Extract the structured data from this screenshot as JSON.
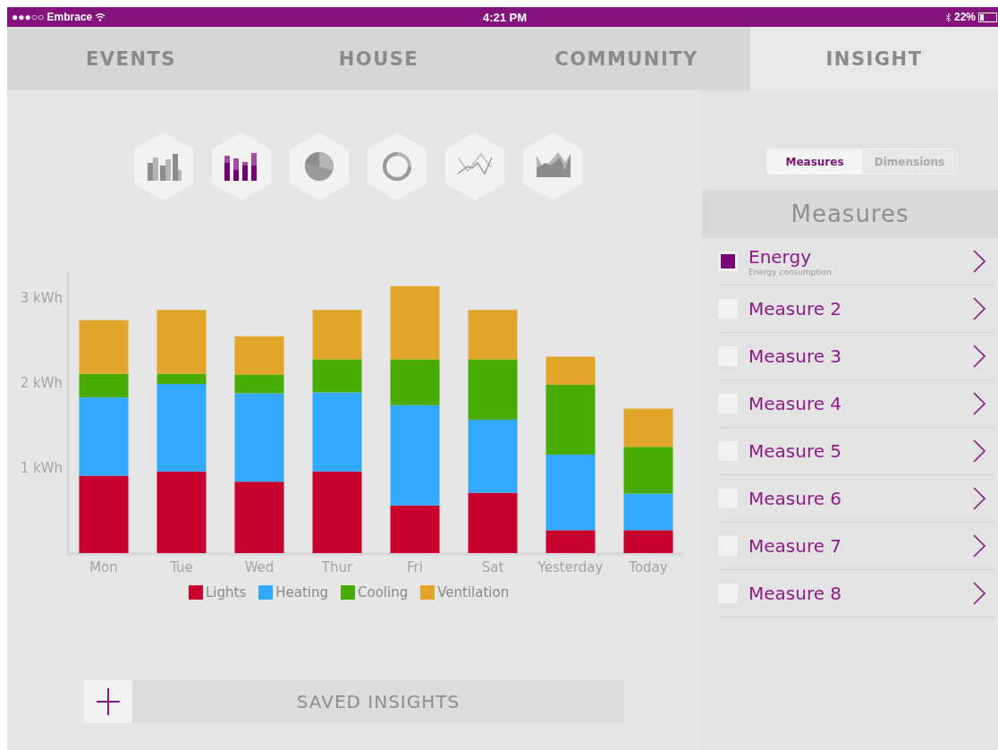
{
  "status_bar": {
    "carrier": "●●●○○ Embrace",
    "time": "4:21 PM",
    "battery": "22%"
  },
  "tabs": [
    {
      "label": "EVENTS",
      "selected": false
    },
    {
      "label": "HOUSE",
      "selected": false
    },
    {
      "label": "COMMUNITY",
      "selected": false
    },
    {
      "label": "INSIGHT",
      "selected": true
    }
  ],
  "chart_types": [
    {
      "kind": "bar",
      "selected": false
    },
    {
      "kind": "stacked",
      "selected": true
    },
    {
      "kind": "pie",
      "selected": false
    },
    {
      "kind": "donut",
      "selected": false
    },
    {
      "kind": "line",
      "selected": false
    },
    {
      "kind": "area",
      "selected": false
    }
  ],
  "chart": {
    "chart_data": {
      "type": "bar",
      "stacked": true,
      "categories": [
        "Mon",
        "Tue",
        "Wed",
        "Thur",
        "Fri",
        "Sat",
        "Yesterday",
        "Today"
      ],
      "ylim": [
        0,
        3.3
      ],
      "yticks": [
        {
          "value": 1,
          "label": "1 kWh"
        },
        {
          "value": 2,
          "label": "2 kWh"
        },
        {
          "value": 3,
          "label": "3 kWh"
        }
      ],
      "series": [
        {
          "name": "Lights",
          "color": "#c8002d",
          "values": [
            0.91,
            0.96,
            0.84,
            0.96,
            0.56,
            0.71,
            0.27,
            0.27
          ]
        },
        {
          "name": "Heating",
          "color": "#33a8ff",
          "values": [
            0.92,
            1.03,
            1.04,
            0.93,
            1.18,
            0.86,
            0.89,
            0.43
          ]
        },
        {
          "name": "Cooling",
          "color": "#48ab00",
          "values": [
            0.28,
            0.12,
            0.22,
            0.39,
            0.54,
            0.71,
            0.82,
            0.55
          ]
        },
        {
          "name": "Ventilation",
          "color": "#e1a52a",
          "values": [
            0.63,
            0.75,
            0.45,
            0.58,
            0.86,
            0.58,
            0.33,
            0.45
          ]
        }
      ]
    }
  },
  "saved_insights": {
    "label": "SAVED INSIGHTS"
  },
  "panel": {
    "segments": [
      {
        "label": "Measures",
        "selected": true
      },
      {
        "label": "Dimensions",
        "selected": false
      }
    ],
    "header": "Measures",
    "items": [
      {
        "name": "Energy",
        "subtitle": "Energy consumption",
        "checked": true
      },
      {
        "name": "Measure 2",
        "checked": false
      },
      {
        "name": "Measure 3",
        "checked": false
      },
      {
        "name": "Measure 4",
        "checked": false
      },
      {
        "name": "Measure 5",
        "checked": false
      },
      {
        "name": "Measure 6",
        "checked": false
      },
      {
        "name": "Measure 7",
        "checked": false
      },
      {
        "name": "Measure 8",
        "checked": false
      }
    ]
  }
}
